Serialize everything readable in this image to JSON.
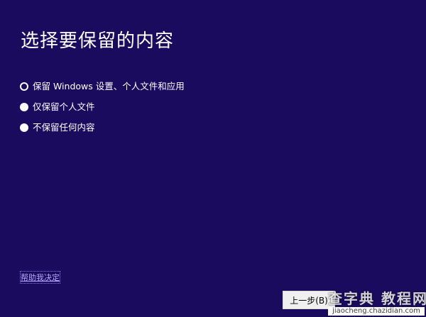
{
  "page": {
    "title": "选择要保留的内容",
    "help_link": "帮助我决定",
    "back_button": "上一步(B)"
  },
  "options": [
    {
      "label": "保留 Windows 设置、个人文件和应用",
      "selected": true
    },
    {
      "label": "仅保留个人文件",
      "selected": false
    },
    {
      "label": "不保留任何内容",
      "selected": false
    }
  ],
  "watermark": {
    "main": "查字典 教程网",
    "url": "jiaocheng.chazidian.com"
  },
  "colors": {
    "background": "#1a0b5e",
    "text": "#ffffff",
    "link": "#b9a9ff"
  }
}
